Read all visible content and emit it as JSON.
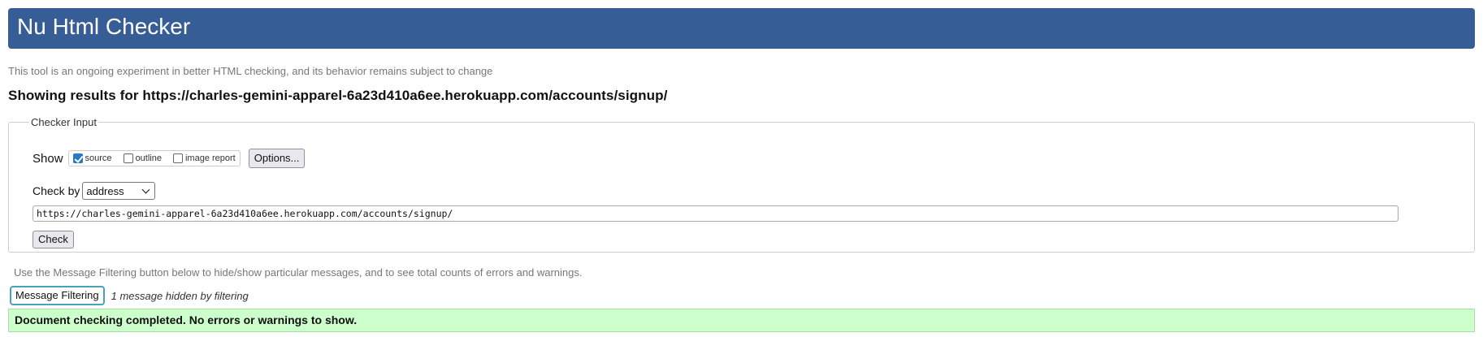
{
  "header": {
    "title": "Nu Html Checker"
  },
  "intro": "This tool is an ongoing experiment in better HTML checking, and its behavior remains subject to change",
  "results_heading": "Showing results for https://charles-gemini-apparel-6a23d410a6ee.herokuapp.com/accounts/signup/",
  "checker_input": {
    "legend": "Checker Input",
    "show_label": "Show",
    "options": [
      {
        "label": "source",
        "checked": true
      },
      {
        "label": "outline",
        "checked": false
      },
      {
        "label": "image report",
        "checked": false
      }
    ],
    "options_button": "Options...",
    "check_by_label": "Check by",
    "check_by_value": "address",
    "url_value": "https://charles-gemini-apparel-6a23d410a6ee.herokuapp.com/accounts/signup/",
    "check_button": "Check"
  },
  "filtering": {
    "note": "Use the Message Filtering button below to hide/show particular messages, and to see total counts of errors and warnings.",
    "button": "Message Filtering",
    "hidden_text": "1 message hidden by filtering"
  },
  "result": {
    "message": "Document checking completed. No errors or warnings to show."
  },
  "colors": {
    "header_bg": "#365d95",
    "success_bg": "#ccffcc",
    "checkbox_on": "#2a78c2",
    "filter_border": "#4aa3b5"
  }
}
